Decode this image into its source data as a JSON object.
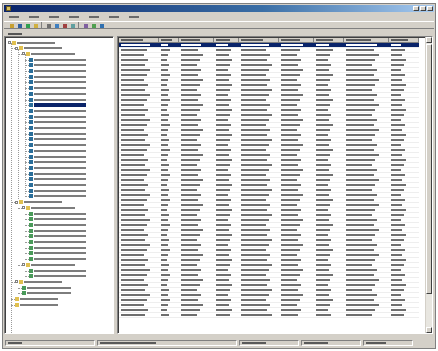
{
  "window": {
    "title": ""
  },
  "menubar": {
    "items": [
      "",
      "",
      "",
      "",
      "",
      "",
      ""
    ]
  },
  "toolbar": {
    "buttons": [
      "open",
      "save",
      "refresh",
      "folder",
      "print",
      "search",
      "copy",
      "filter",
      "grid",
      "export",
      "help"
    ]
  },
  "addressbar": {
    "value": ""
  },
  "tree": {
    "nodes": [
      {
        "label": "",
        "level": 0,
        "icon": "folder",
        "expanded": true
      },
      {
        "label": "",
        "level": 1,
        "icon": "folder",
        "expanded": true
      },
      {
        "label": "",
        "level": 2,
        "icon": "folder",
        "expanded": true
      },
      {
        "label": "",
        "level": 3,
        "icon": "item"
      },
      {
        "label": "",
        "level": 3,
        "icon": "item"
      },
      {
        "label": "",
        "level": 3,
        "icon": "item"
      },
      {
        "label": "",
        "level": 3,
        "icon": "item"
      },
      {
        "label": "",
        "level": 3,
        "icon": "item"
      },
      {
        "label": "",
        "level": 3,
        "icon": "item"
      },
      {
        "label": "",
        "level": 3,
        "icon": "item"
      },
      {
        "label": "",
        "level": 3,
        "icon": "item"
      },
      {
        "label": "",
        "level": 3,
        "icon": "item",
        "selected": true
      },
      {
        "label": "",
        "level": 3,
        "icon": "item"
      },
      {
        "label": "",
        "level": 3,
        "icon": "item"
      },
      {
        "label": "",
        "level": 3,
        "icon": "item"
      },
      {
        "label": "",
        "level": 3,
        "icon": "item"
      },
      {
        "label": "",
        "level": 3,
        "icon": "item"
      },
      {
        "label": "",
        "level": 3,
        "icon": "item"
      },
      {
        "label": "",
        "level": 3,
        "icon": "item"
      },
      {
        "label": "",
        "level": 3,
        "icon": "item"
      },
      {
        "label": "",
        "level": 3,
        "icon": "item"
      },
      {
        "label": "",
        "level": 3,
        "icon": "item"
      },
      {
        "label": "",
        "level": 3,
        "icon": "item"
      },
      {
        "label": "",
        "level": 3,
        "icon": "item"
      },
      {
        "label": "",
        "level": 3,
        "icon": "item"
      },
      {
        "label": "",
        "level": 3,
        "icon": "item"
      },
      {
        "label": "",
        "level": 3,
        "icon": "item"
      },
      {
        "label": "",
        "level": 3,
        "icon": "item"
      },
      {
        "label": "",
        "level": 1,
        "icon": "folder",
        "expanded": true
      },
      {
        "label": "",
        "level": 2,
        "icon": "folder",
        "expanded": true
      },
      {
        "label": "",
        "level": 3,
        "icon": "doc"
      },
      {
        "label": "",
        "level": 3,
        "icon": "doc"
      },
      {
        "label": "",
        "level": 3,
        "icon": "doc"
      },
      {
        "label": "",
        "level": 3,
        "icon": "doc"
      },
      {
        "label": "",
        "level": 3,
        "icon": "doc"
      },
      {
        "label": "",
        "level": 3,
        "icon": "doc"
      },
      {
        "label": "",
        "level": 3,
        "icon": "doc"
      },
      {
        "label": "",
        "level": 3,
        "icon": "doc"
      },
      {
        "label": "",
        "level": 3,
        "icon": "doc"
      },
      {
        "label": "",
        "level": 2,
        "icon": "folder",
        "expanded": true
      },
      {
        "label": "",
        "level": 3,
        "icon": "doc"
      },
      {
        "label": "",
        "level": 3,
        "icon": "doc"
      },
      {
        "label": "",
        "level": 1,
        "icon": "folder",
        "expanded": true
      },
      {
        "label": "",
        "level": 2,
        "icon": "doc"
      },
      {
        "label": "",
        "level": 2,
        "icon": "doc"
      },
      {
        "label": "",
        "level": 1,
        "icon": "folder"
      },
      {
        "label": "",
        "level": 1,
        "icon": "folder"
      }
    ]
  },
  "grid": {
    "columns": [
      "",
      "",
      "",
      "",
      "",
      "",
      "",
      "",
      ""
    ],
    "rows": 55,
    "selected_row": 0
  },
  "statusbar": {
    "panes": [
      "",
      "",
      "",
      "",
      ""
    ]
  }
}
